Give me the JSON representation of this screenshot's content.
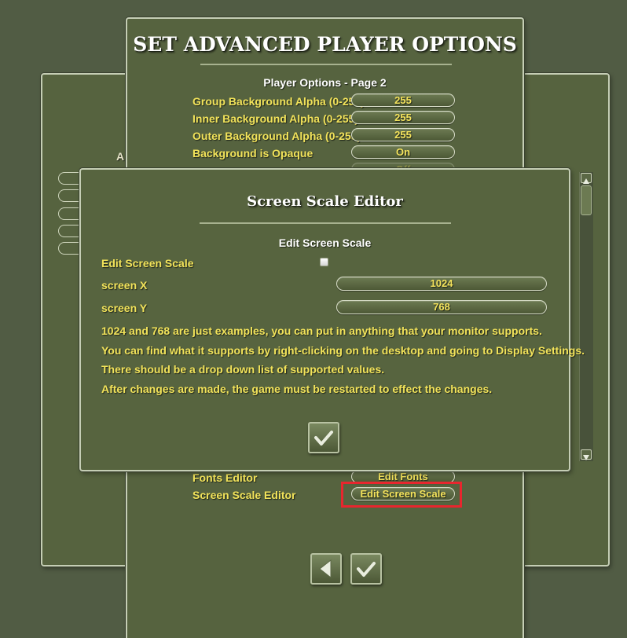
{
  "main_panel": {
    "title": "SET ADVANCED PLAYER OPTIONS",
    "subtitle": "Player Options - Page 2",
    "options": [
      {
        "label": "Group Background Alpha (0-255)",
        "value": "255"
      },
      {
        "label": "Inner Background Alpha (0-255)",
        "value": "255"
      },
      {
        "label": "Outer Background Alpha (0-255)",
        "value": "255"
      },
      {
        "label": "Background is Opaque",
        "value": "On"
      }
    ],
    "partial_option_value": "Off",
    "fonts_editor": {
      "label": "Fonts Editor",
      "button": "Edit Fonts"
    },
    "screen_scale_editor": {
      "label": "Screen Scale Editor",
      "button": "Edit Screen Scale"
    }
  },
  "back_panel": {
    "partial_text": "A"
  },
  "modal": {
    "title": "Screen Scale Editor",
    "subtitle": "Edit Screen Scale",
    "edit_label": "Edit Screen Scale",
    "screen_x": {
      "label": "screen X",
      "value": "1024"
    },
    "screen_y": {
      "label": "screen Y",
      "value": "768"
    },
    "notes": [
      "1024 and 768 are just examples, you can put in anything that your monitor supports.",
      "You can find what it supports by right-clicking on the desktop and going to Display Settings.",
      "There should be a drop down list of supported values.",
      "After changes are made, the game must be restarted to effect the changes."
    ]
  },
  "colors": {
    "panel": "#56633f",
    "label_yellow": "#f2e35a",
    "highlight_red": "#e8262e"
  }
}
